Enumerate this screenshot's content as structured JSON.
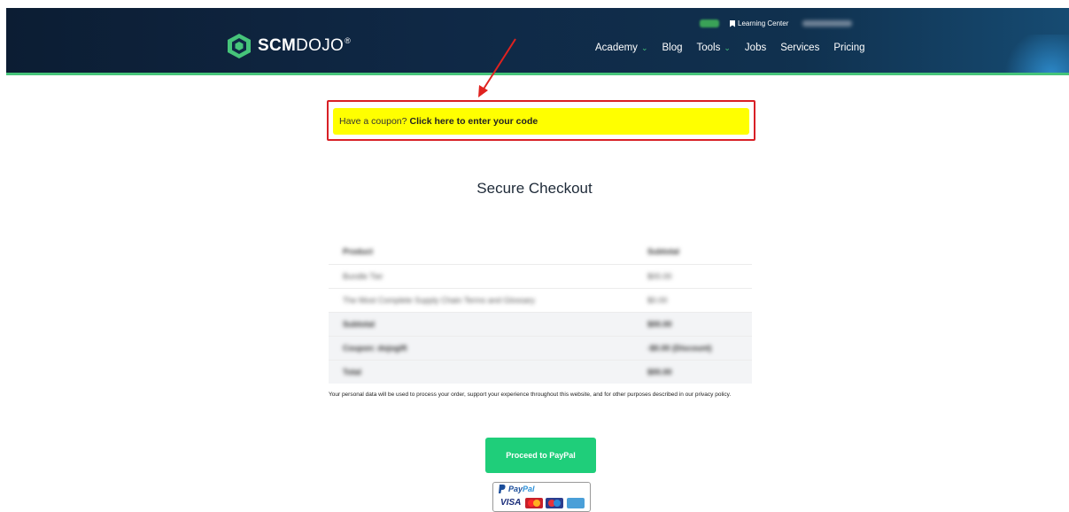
{
  "header": {
    "logo_text_bold": "SCM",
    "logo_text_light": "DOJO",
    "logo_reg": "®",
    "top_link": "Learning Center",
    "nav": [
      {
        "label": "Academy",
        "dropdown": true
      },
      {
        "label": "Blog",
        "dropdown": false
      },
      {
        "label": "Tools",
        "dropdown": true
      },
      {
        "label": "Jobs",
        "dropdown": false
      },
      {
        "label": "Services",
        "dropdown": false
      },
      {
        "label": "Pricing",
        "dropdown": false
      }
    ],
    "chevron": "⌄"
  },
  "coupon": {
    "prefix": "Have a coupon?",
    "link": "Click here to enter your code"
  },
  "page_title": "Secure Checkout",
  "order_table": {
    "rows": [
      {
        "col1": "Product",
        "col2": "Subtotal",
        "shade": false,
        "bold": true
      },
      {
        "col1": "Bundle Tier",
        "col2": "$00.00",
        "shade": false,
        "bold": false
      },
      {
        "col1": "The Most Complete Supply Chain Terms and Glossary",
        "col2": "$0.00",
        "shade": false,
        "bold": false
      },
      {
        "col1": "Subtotal",
        "col2": "$00.00",
        "shade": true,
        "bold": true
      },
      {
        "col1": "Coupon: dojogift",
        "col2": "-$0.00 (Discount)",
        "shade": true,
        "bold": true
      },
      {
        "col1": "Total",
        "col2": "$00.00",
        "shade": true,
        "bold": true
      }
    ]
  },
  "privacy_text": "Your personal data will be used to process your order, support your experience throughout this website, and for other purposes described in our privacy policy.",
  "paypal_button": "Proceed to PayPal",
  "cards": {
    "paypal_dark": "Pay",
    "paypal_light": "Pal",
    "visa": "VISA"
  },
  "colors": {
    "header_bg": "#0f2845",
    "accent_green": "#46c47a",
    "coupon_bg": "#ffff00",
    "highlight_red": "#d82026",
    "button_green": "#1fce7a"
  }
}
